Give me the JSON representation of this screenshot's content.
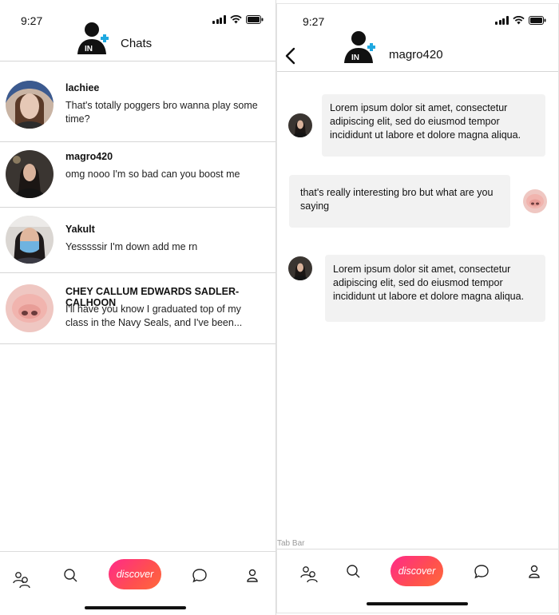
{
  "status_bar": {
    "time": "9:27"
  },
  "colors": {
    "accent_blue": "#1fa8e0",
    "discover_gradient_start": "#ff2a8a",
    "discover_gradient_end": "#ff6a3c",
    "bubble_bg": "#f2f2f2"
  },
  "chats_screen": {
    "title": "Chats",
    "chats": [
      {
        "name": "lachiee",
        "preview": "That's totally poggers bro wanna play some time?"
      },
      {
        "name": "magro420",
        "preview": "omg nooo I'm so bad can you boost me"
      },
      {
        "name": "Yakult",
        "preview": "Yesssssir I'm down add me rn"
      },
      {
        "name": "CHEY CALLUM EDWARDS SADLER-CALHOON",
        "preview": "I'll have you know I graduated top of my class in the Navy Seals, and I've been..."
      }
    ]
  },
  "conversation_screen": {
    "contact_name": "magro420",
    "messages": [
      {
        "sender": "contact",
        "text": "Lorem ipsum dolor sit amet, consectetur adipiscing elit, sed do eiusmod tempor incididunt ut labore et dolore magna aliqua."
      },
      {
        "sender": "me",
        "text": "that's really interesting bro but what are you saying"
      },
      {
        "sender": "contact",
        "text": "Lorem ipsum dolor sit amet, consectetur adipiscing elit, sed do eiusmod tempor incididunt ut labore et dolore magna aliqua."
      }
    ]
  },
  "tab_bar": {
    "label": "Tab Bar",
    "discover_label": "discover",
    "icons": [
      "friends-icon",
      "search-icon",
      "chat-icon",
      "profile-icon"
    ]
  }
}
